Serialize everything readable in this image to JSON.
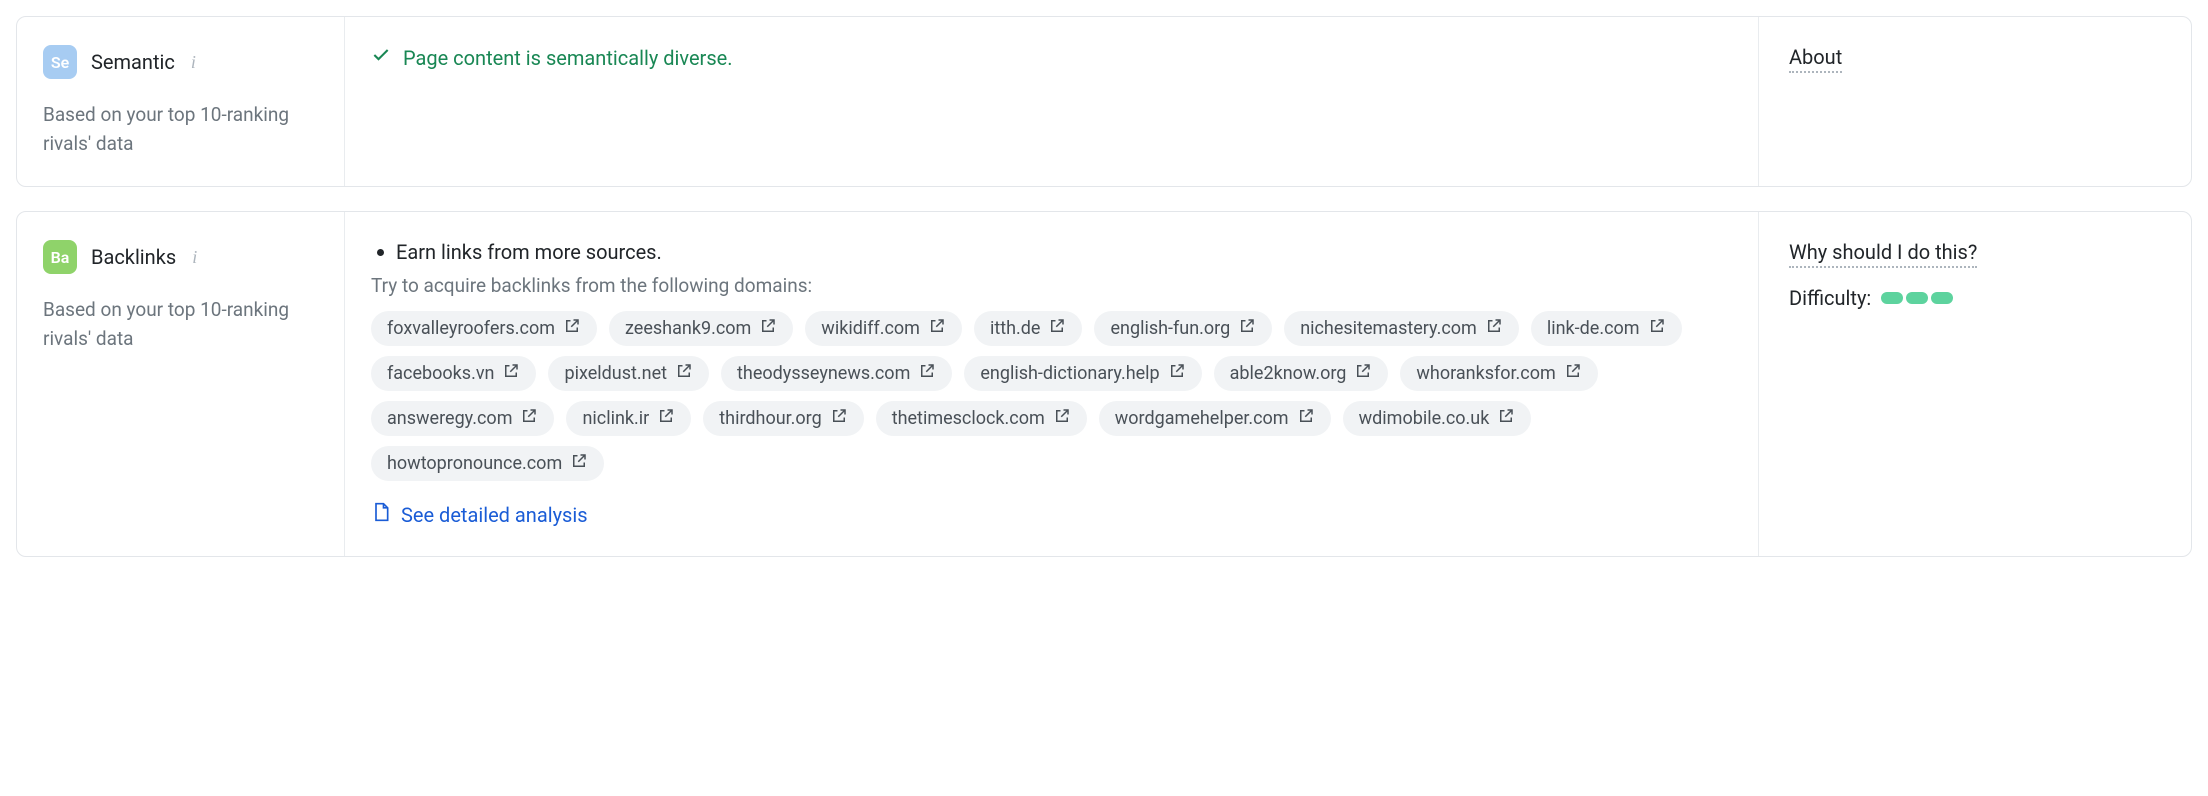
{
  "semantic": {
    "badge": "Se",
    "title": "Semantic",
    "sub": "Based on your top 10-ranking rivals' data",
    "status": "Page content is semantically diverse.",
    "about": "About"
  },
  "backlinks": {
    "badge": "Ba",
    "title": "Backlinks",
    "sub": "Based on your top 10-ranking rivals' data",
    "bullet": "Earn links from more sources.",
    "try": "Try to acquire backlinks from the following domains:",
    "domains": [
      "foxvalleyroofers.com",
      "zeeshank9.com",
      "wikidiff.com",
      "itth.de",
      "english-fun.org",
      "nichesitemastery.com",
      "link-de.com",
      "facebooks.vn",
      "pixeldust.net",
      "theodysseynews.com",
      "english-dictionary.help",
      "able2know.org",
      "whoranksfor.com",
      "answeregy.com",
      "niclink.ir",
      "thirdhour.org",
      "thetimesclock.com",
      "wordgamehelper.com",
      "wdimobile.co.uk",
      "howtopronounce.com"
    ],
    "detailed": "See detailed analysis",
    "why": "Why should I do this?",
    "difficulty_label": "Difficulty:",
    "difficulty_level": 3
  }
}
